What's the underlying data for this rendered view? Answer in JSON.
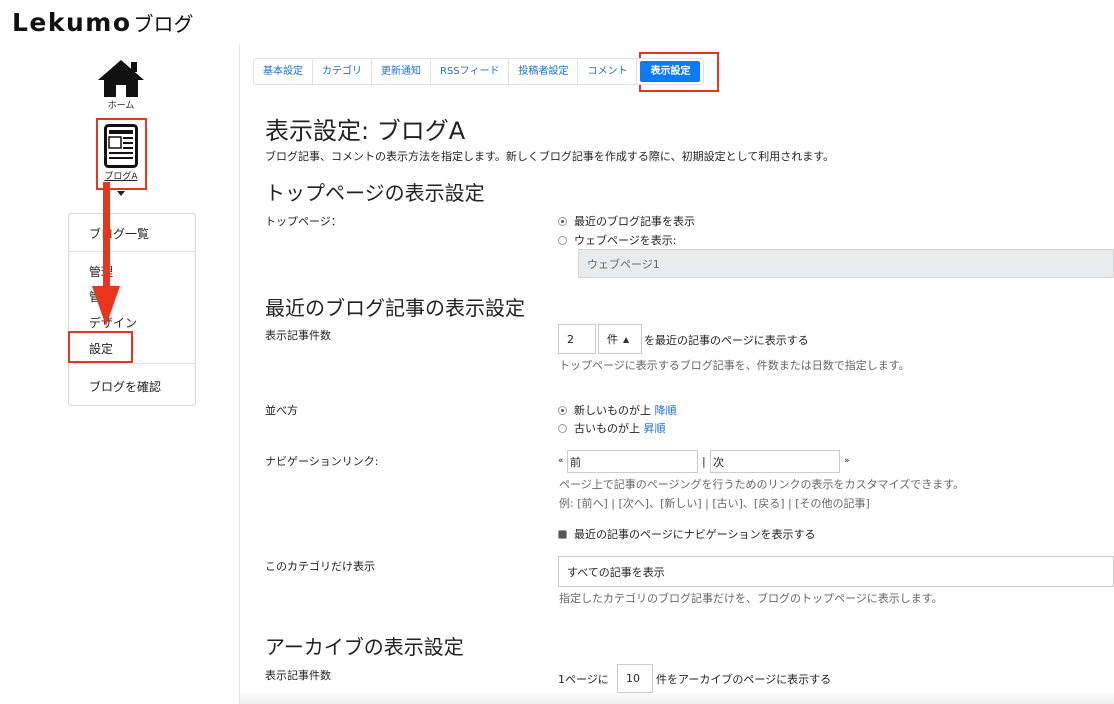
{
  "header": {
    "logo_text": "Lekumo",
    "logo_suffix": "ブログ"
  },
  "sidebar": {
    "home_label": "ホーム",
    "blog_label": "ブログA",
    "menu": {
      "blog_list": "ブログ一覧",
      "manage": "管理",
      "manage_second": "管",
      "design": "デザイン",
      "settings": "設定",
      "view_blog": "ブログを確認"
    }
  },
  "tabs": [
    {
      "label": "基本設定"
    },
    {
      "label": "カテゴリ"
    },
    {
      "label": "更新通知"
    },
    {
      "label": "RSSフィード"
    },
    {
      "label": "投稿者設定"
    },
    {
      "label": "コメント"
    },
    {
      "label": "表示設定",
      "active": true
    }
  ],
  "page": {
    "title": "表示設定: ブログA",
    "description": "ブログ記事、コメントの表示方法を指定します。新しくブログ記事を作成する際に、初期設定として利用されます。"
  },
  "top_section": {
    "heading": "トップページの表示設定",
    "label": "トップページ：",
    "option_recent": "最近のブログ記事を表示",
    "option_webpage": "ウェブページを表示:",
    "webpage_value": "ウェブページ1"
  },
  "recent_section": {
    "heading": "最近のブログ記事の表示設定",
    "count_label": "表示記事件数",
    "count_value": "2",
    "unit_value": "件",
    "count_suffix": "を最近の記事のページに表示する",
    "count_help": "トップページに表示するブログ記事を、件数または日数で指定します。",
    "order_label": "並べ方",
    "order_new": "新しいものが上",
    "order_new_tag": "降順",
    "order_old": "古いものが上",
    "order_old_tag": "昇順",
    "nav_label": "ナビゲーションリンク:",
    "nav_open": "«",
    "nav_prev": "前",
    "nav_sep": "|",
    "nav_next": "次",
    "nav_close": "»",
    "nav_help1": "ページ上で記事のページングを行うためのリンクの表示をカスタマイズできます。",
    "nav_help2": "例: [前へ] | [次へ]、[新しい] | [古い]、[戻る] | [その他の記事]",
    "nav_show_check": "最近の記事のページにナビゲーションを表示する",
    "category_label": "このカテゴリだけ表示",
    "category_value": "すべての記事を表示",
    "category_help": "指定したカテゴリのブログ記事だけを、ブログのトップページに表示します。"
  },
  "archive_section": {
    "heading": "アーカイブの表示設定",
    "count_label": "表示記事件数",
    "count_prefix": "1ページに",
    "count_value": "10",
    "count_suffix": "件をアーカイブのページに表示する"
  },
  "colors": {
    "accent": "#0d7bf2",
    "highlight": "#e8351d",
    "link": "#1a6ed8"
  }
}
